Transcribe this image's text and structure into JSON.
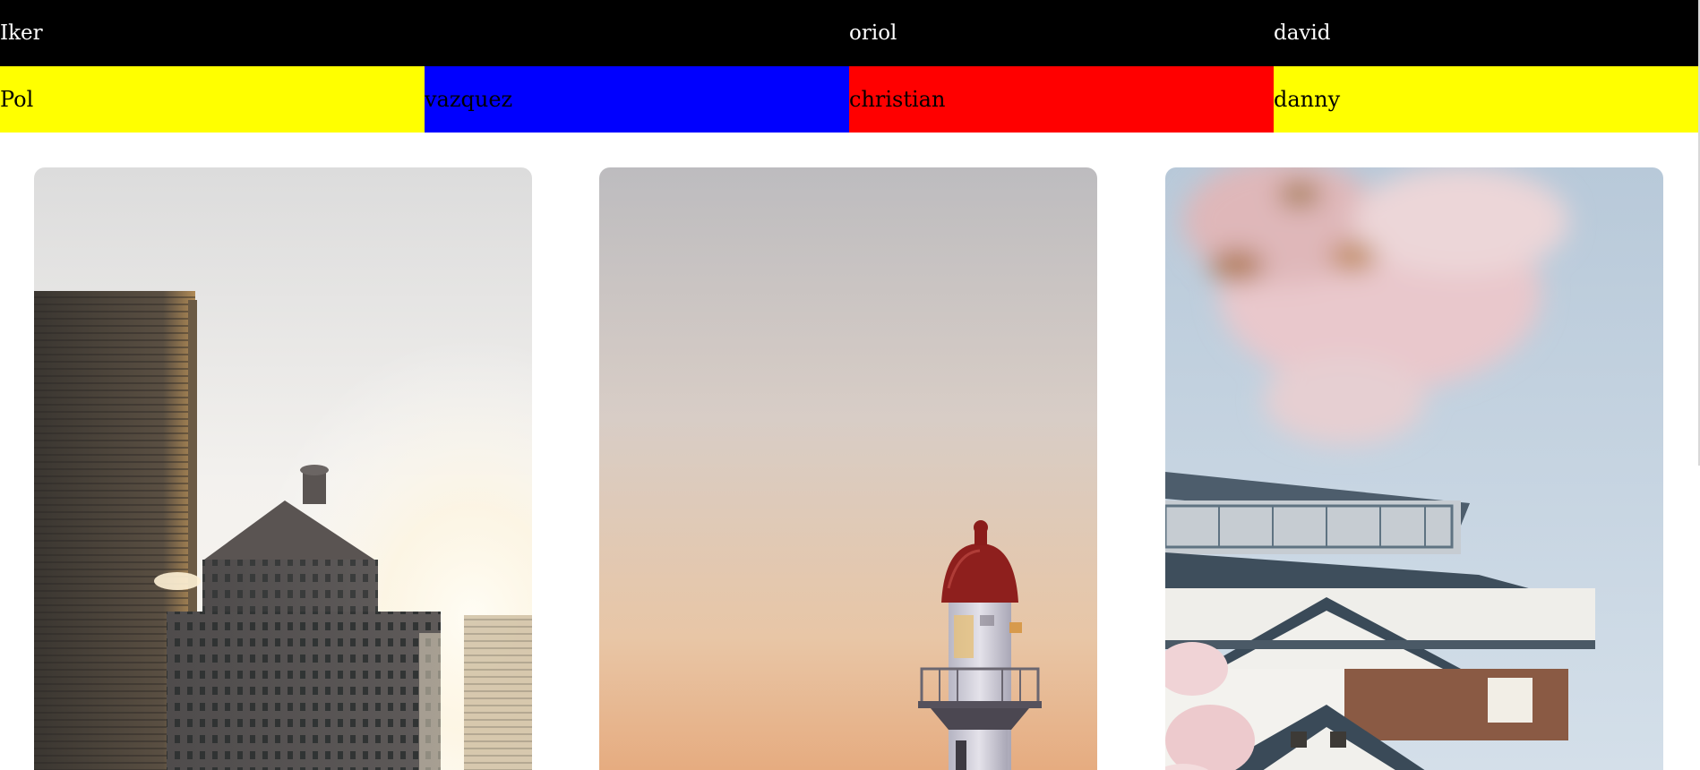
{
  "top_row": [
    {
      "label": "Iker",
      "bg": "#000000",
      "fg": "#ffffff"
    },
    {
      "label": "",
      "bg": "#000000",
      "fg": "#ffffff"
    },
    {
      "label": "oriol",
      "bg": "#000000",
      "fg": "#ffffff"
    },
    {
      "label": "david",
      "bg": "#000000",
      "fg": "#ffffff"
    }
  ],
  "bottom_row": [
    {
      "label": "Pol",
      "bg": "#ffff00",
      "fg": "#000000"
    },
    {
      "label": "vazquez",
      "bg": "#0000ff",
      "fg": "#000000"
    },
    {
      "label": "christian",
      "bg": "#ff0000",
      "fg": "#000000"
    },
    {
      "label": "danny",
      "bg": "#ffff00",
      "fg": "#000000"
    }
  ],
  "gallery": [
    {
      "subject": "city-skyline-sunrise"
    },
    {
      "subject": "lighthouse-at-dusk"
    },
    {
      "subject": "japanese-castle-cherry-blossoms"
    }
  ]
}
